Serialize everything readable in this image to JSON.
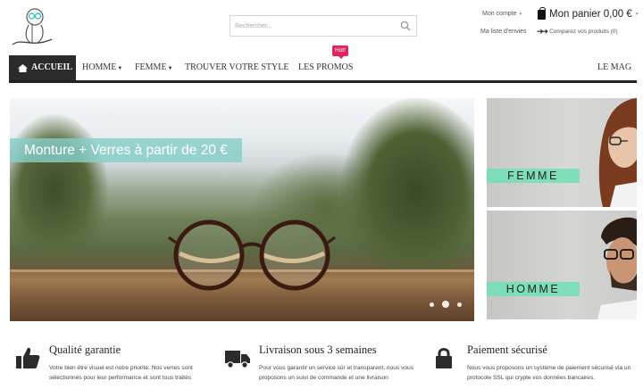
{
  "header": {
    "search_placeholder": "Rechercher...",
    "account_label": "Mon compte",
    "wishlist_label": "Ma liste d'envies",
    "cart_label": "Mon panier",
    "cart_total": "0,00 €",
    "compare_label": "Comparez vos produits (0)"
  },
  "nav": {
    "items": [
      {
        "label": "ACCUEIL",
        "active": true
      },
      {
        "label": "HOMME",
        "has_dropdown": true
      },
      {
        "label": "FEMME",
        "has_dropdown": true
      },
      {
        "label": "TROUVER VOTRE STYLE"
      },
      {
        "label": "LES PROMOS"
      },
      {
        "label": "LE MAG"
      }
    ],
    "badge": "Hot!"
  },
  "hero": {
    "caption": "Monture + Verres à partir de 20 €",
    "slide_count": 3,
    "active_slide": 2
  },
  "banners": [
    {
      "label": "FEMME"
    },
    {
      "label": "HOMME"
    }
  ],
  "features": [
    {
      "icon": "thumbs-up-icon",
      "title": "Qualité garantie",
      "text": "Votre bien être visuel est notre priorité. Nos verres sont sélectionnés pour leur performance et sont tous traités"
    },
    {
      "icon": "truck-icon",
      "title": "Livraison sous 3 semaines",
      "text": "Pour vous garantir un service sûr et transparent, nous vous proposons un suivi de commande et une livraison"
    },
    {
      "icon": "lock-icon",
      "title": "Paiement sécurisé",
      "text": "Nous vous proposons un système de paiement sécurisé via un protocole SSL qui crypte vos données bancaires."
    }
  ],
  "colors": {
    "nav_active_bg": "#2b2b2b",
    "hot_badge": "#e0245e",
    "hero_caption_bg": "#87cec8",
    "banner_label_bg": "#6ee1b4"
  }
}
